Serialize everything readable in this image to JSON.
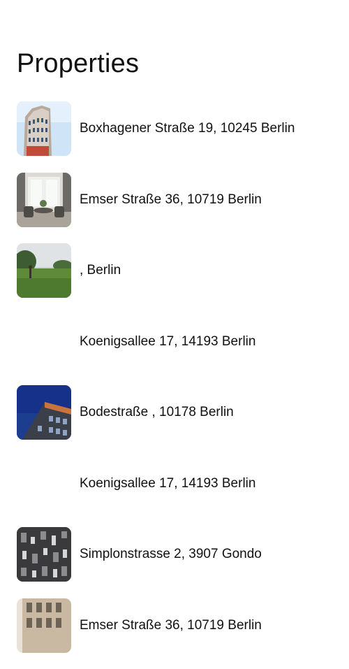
{
  "header": {
    "title": "Properties"
  },
  "properties": [
    {
      "address": "Boxhagener Straße 19, 10245 Berlin",
      "image": "building-facade-photo"
    },
    {
      "address": "Emser Straße 36, 10719 Berlin",
      "image": "interior-living-room-photo"
    },
    {
      "address": ",  Berlin",
      "image": "park-lawn-photo"
    },
    {
      "address": "Koenigsallee 17, 14193 Berlin",
      "image": ""
    },
    {
      "address": "Bodestraße , 10178 Berlin",
      "image": "modern-building-blue-sky-photo"
    },
    {
      "address": "Koenigsallee 17, 14193 Berlin",
      "image": ""
    },
    {
      "address": "Simplonstrasse 2, 3907 Gondo",
      "image": "dark-facade-windows-photo"
    },
    {
      "address": "Emser Straße 36, 10719 Berlin",
      "image": "old-building-facade-photo"
    }
  ]
}
